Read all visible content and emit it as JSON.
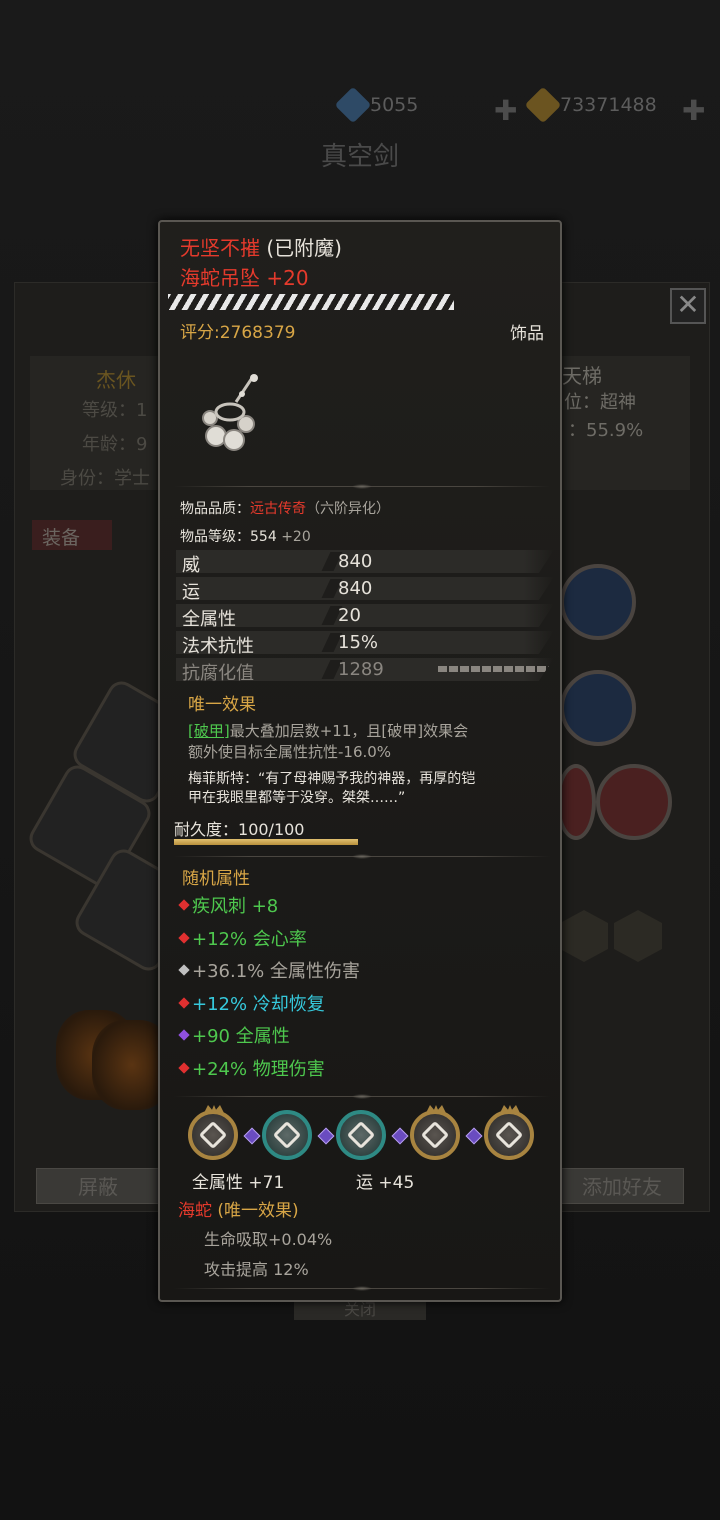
{
  "background": {
    "currencies": [
      {
        "icon": "blue-gem-icon",
        "value": "5055"
      },
      {
        "icon": "gold-gem-icon",
        "value": "73371488"
      }
    ],
    "title": "真空剑",
    "profile_name": "杰休",
    "profile_rows": [
      "等级：1",
      "年龄：9",
      "身份：学士"
    ],
    "right_rows": [
      "天梯",
      "位：超神",
      "：55.9%"
    ],
    "equip_tab": "装备",
    "buttons": {
      "block": "屏蔽",
      "add_friend": "添加好友",
      "bottom": "关闭"
    }
  },
  "item": {
    "prefix": "无坚不摧",
    "enchant_state": "(已附魔)",
    "name": "海蛇吊坠 +20",
    "score_label": "评分:",
    "score": "2768379",
    "category": "饰品",
    "quality_label": "物品品质：",
    "quality": "远古传奇",
    "quality_tier": "（六阶异化）",
    "level_label": "物品等级：",
    "level": "554",
    "level_bonus": "+20",
    "stats": [
      {
        "label": "威",
        "value": "840"
      },
      {
        "label": "运",
        "value": "840"
      },
      {
        "label": "全属性",
        "value": "20"
      },
      {
        "label": "法术抗性",
        "value": "15%"
      },
      {
        "label": "抗腐化值",
        "value": "1289"
      }
    ],
    "unique_title": "唯一效果",
    "unique_tag": "[破甲]",
    "unique_line1": "最大叠加层数+11，且[破甲]效果会",
    "unique_line2": "额外使目标全属性抗性-16.0%",
    "lore_line1": "梅菲斯特：“有了母神赐予我的神器，再厚的铠",
    "lore_line2": "甲在我眼里都等于没穿。桀桀……”",
    "durability_label": "耐久度：",
    "durability": "100/100",
    "durability_fraction": 1.0,
    "random_title": "随机属性",
    "random_attrs": [
      {
        "text": "疾风刺 +8",
        "color": "#4ec84e",
        "gem": "#e03030"
      },
      {
        "text": "+12% 会心率",
        "color": "#4ec84e",
        "gem": "#e03030"
      },
      {
        "text": "+36.1% 全属性伤害",
        "color": "#a8a49c",
        "gem": "#c0c0c0"
      },
      {
        "text": "+12% 冷却恢复",
        "color": "#36c9dc",
        "gem": "#e03030"
      },
      {
        "text": "+90 全属性",
        "color": "#4ec84e",
        "gem": "#9050e0"
      },
      {
        "text": "+24% 物理伤害",
        "color": "#4ec84e",
        "gem": "#e03030"
      }
    ],
    "socket_bonus_1": "全属性 +71",
    "socket_bonus_2": "运 +45",
    "set_name": "海蛇",
    "set_tag": "(唯一效果)",
    "set_line1": "生命吸取+0.04%",
    "set_line2": "攻击提高 12%"
  }
}
